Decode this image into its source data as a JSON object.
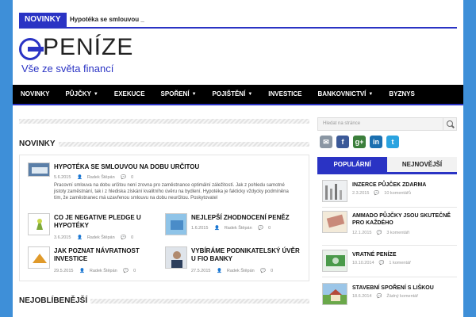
{
  "ticker": {
    "label": "NOVINKY",
    "text": "Hypotéka se smlouvou _"
  },
  "logo": {
    "title": "PENÍZE",
    "tagline": "Vše ze světa financí"
  },
  "nav": [
    {
      "label": "NOVINKY",
      "dropdown": false
    },
    {
      "label": "PŮJČKY",
      "dropdown": true
    },
    {
      "label": "EXEKUCE",
      "dropdown": false
    },
    {
      "label": "SPOŘENÍ",
      "dropdown": true
    },
    {
      "label": "POJIŠTĚNÍ",
      "dropdown": true
    },
    {
      "label": "INVESTICE",
      "dropdown": false
    },
    {
      "label": "BANKOVNICTVÍ",
      "dropdown": true
    },
    {
      "label": "BYZNYS",
      "dropdown": false
    }
  ],
  "news": {
    "title": "NOVINKY",
    "featured": {
      "title": "HYPOTÉKA SE SMLOUVOU NA DOBU URČITOU",
      "date": "5.6.2015",
      "author": "Radek Štěpán",
      "comments": "0",
      "excerpt": "Pracovní smlouva na dobu určitou není zrovna pro zaměstnance optimální záležitostí. Jak z pohledu samotné jistoty zaměstnání, tak i z hlediska získání kvalitního úvěru na bydlení. Hypotéka je fakticky vždycky podmíněna tím, že zaměstnanec má uzavřenou smlouvu na dobu neurčitou. Poskytovatel"
    },
    "posts": [
      {
        "title": "CO JE NEGATIVE PLEDGE U HYPOTÉKY",
        "date": "3.6.2015",
        "author": "Radek Štěpán",
        "comments": "0"
      },
      {
        "title": "NEJLEPŠÍ ZHODNOCENÍ PENĚZ",
        "date": "1.6.2015",
        "author": "Radek Štěpán",
        "comments": "0"
      },
      {
        "title": "JAK POZNAT NÁVRATNOST INVESTICE",
        "date": "29.5.2015",
        "author": "Radek Štěpán",
        "comments": "0"
      },
      {
        "title": "VYBÍRÁME PODNIKATELSKÝ ÚVĚR U FIO BANKY",
        "date": "27.5.2015",
        "author": "Radek Štěpán",
        "comments": "0"
      }
    ]
  },
  "popular_section": {
    "title": "NEJOBLÍBENĚJŠÍ"
  },
  "sidebar": {
    "search_placeholder": "Hledat na stránce",
    "social": [
      {
        "icon": "mail-icon",
        "glyph": "✉",
        "color": "#8a96a3"
      },
      {
        "icon": "facebook-icon",
        "glyph": "f",
        "color": "#3b5998"
      },
      {
        "icon": "google-plus-icon",
        "glyph": "g+",
        "color": "#3c7f3c"
      },
      {
        "icon": "linkedin-icon",
        "glyph": "in",
        "color": "#1a6fb0"
      },
      {
        "icon": "twitter-icon",
        "glyph": "t",
        "color": "#2aa3e0"
      }
    ],
    "tabs": {
      "active": "POPULÁRNÍ",
      "inactive": "NEJNOVĚJŠÍ"
    },
    "items": [
      {
        "title": "INZERCE PŮJČEK ZDARMA",
        "date": "2.3.2015",
        "comments": "10 komentářů"
      },
      {
        "title": "AMMADO PŮJČKY JSOU SKUTEČNĚ PRO KAŽDÉHO",
        "date": "12.1.2015",
        "comments": "3 komentáři"
      },
      {
        "title": "VRATNÉ PENÍZE",
        "date": "10.10.2014",
        "comments": "1 komentář"
      },
      {
        "title": "STAVEBNÍ SPOŘENÍ S LIŠKOU",
        "date": "18.6.2014",
        "comments": "Žádný komentář"
      }
    ]
  },
  "colors": {
    "accent": "#2a33c4",
    "background": "#3e8fd8",
    "nav": "#000000"
  }
}
